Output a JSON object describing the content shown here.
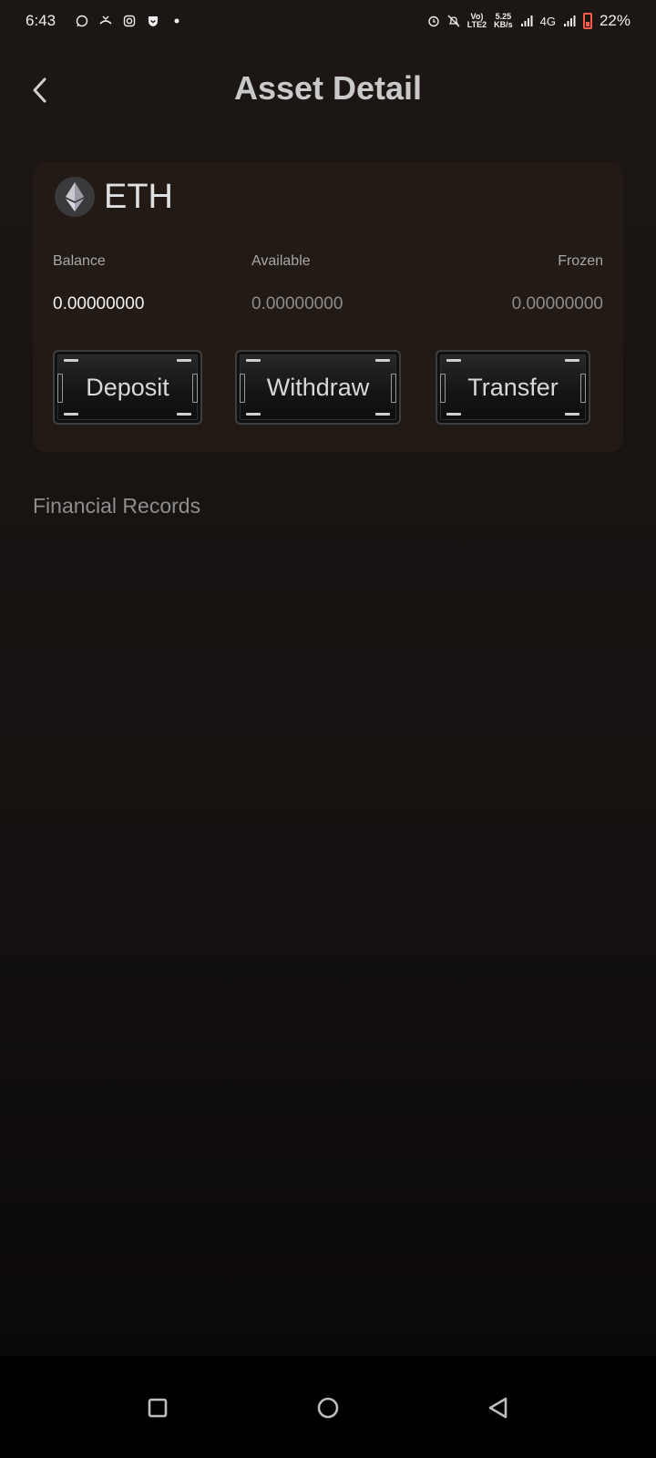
{
  "status_bar": {
    "time": "6:43",
    "network_speed_top": "5.25",
    "network_speed_unit": "KB/s",
    "volte_label": "Vo)",
    "lte_label": "LTE2",
    "network_type": "4G",
    "battery_percent": "22%",
    "battery_color": "#ff5a4a",
    "left_icons": [
      "whatsapp-icon",
      "missed-call-icon",
      "instagram-icon",
      "shield-icon",
      "dot-icon"
    ]
  },
  "header": {
    "title": "Asset Detail",
    "back_icon": "chevron-left-icon"
  },
  "asset": {
    "symbol": "ETH",
    "logo_icon": "ethereum-icon",
    "balance_label": "Balance",
    "balance_value": "0.00000000",
    "available_label": "Available",
    "available_value": "0.00000000",
    "frozen_label": "Frozen",
    "frozen_value": "0.00000000"
  },
  "actions": {
    "deposit": "Deposit",
    "withdraw": "Withdraw",
    "transfer": "Transfer"
  },
  "records": {
    "title": "Financial Records"
  },
  "nav": {
    "icons": [
      "recent-apps-icon",
      "home-icon",
      "back-triangle-icon"
    ]
  }
}
